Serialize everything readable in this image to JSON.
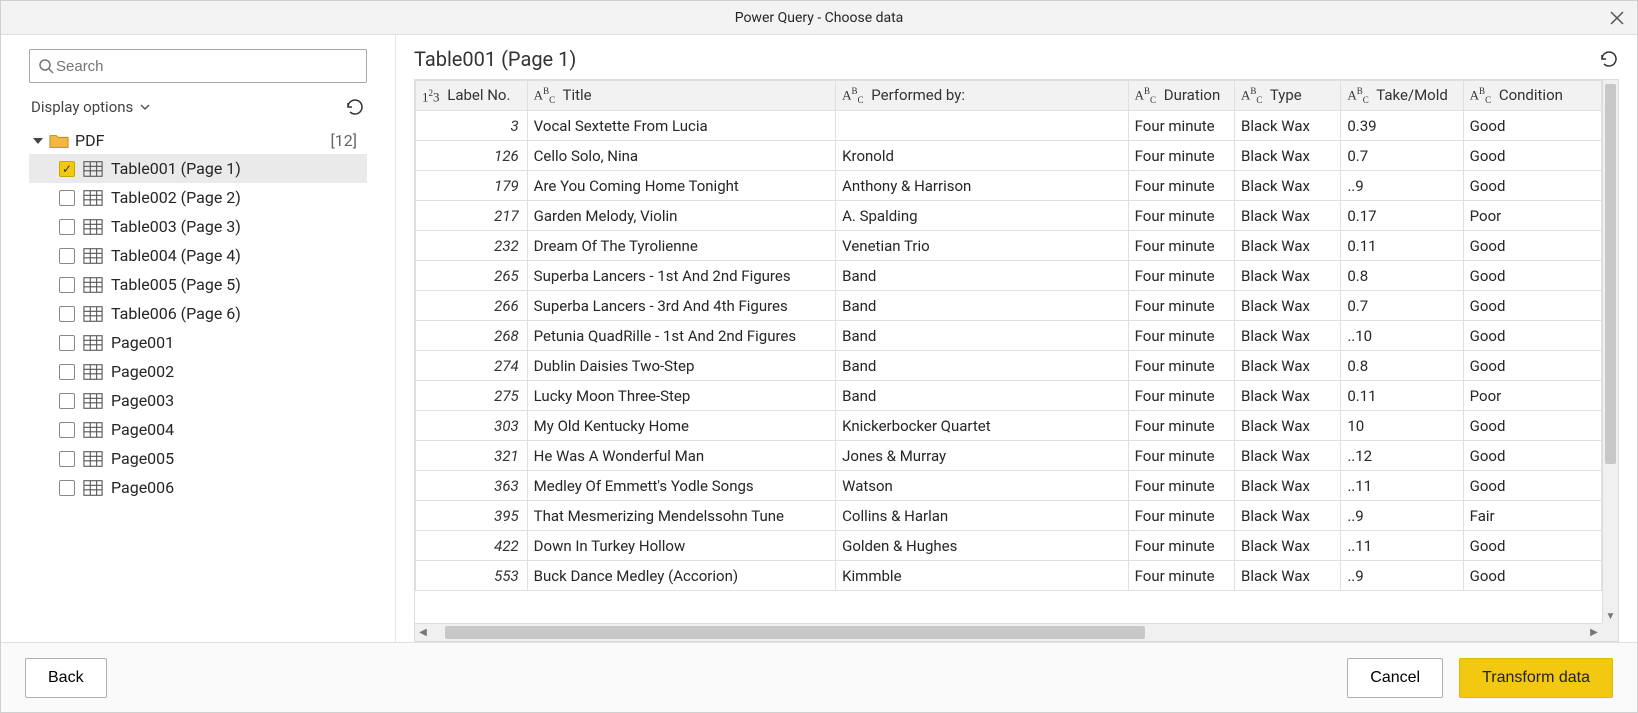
{
  "window": {
    "title": "Power Query - Choose data"
  },
  "search": {
    "placeholder": "Search"
  },
  "display_options": {
    "label": "Display options"
  },
  "tree": {
    "root_label": "PDF",
    "root_count": "[12]",
    "items": [
      {
        "label": "Table001 (Page 1)",
        "checked": true,
        "kind": "table",
        "selected": true
      },
      {
        "label": "Table002 (Page 2)",
        "checked": false,
        "kind": "table",
        "selected": false
      },
      {
        "label": "Table003 (Page 3)",
        "checked": false,
        "kind": "table",
        "selected": false
      },
      {
        "label": "Table004 (Page 4)",
        "checked": false,
        "kind": "table",
        "selected": false
      },
      {
        "label": "Table005 (Page 5)",
        "checked": false,
        "kind": "table",
        "selected": false
      },
      {
        "label": "Table006 (Page 6)",
        "checked": false,
        "kind": "table",
        "selected": false
      },
      {
        "label": "Page001",
        "checked": false,
        "kind": "page",
        "selected": false
      },
      {
        "label": "Page002",
        "checked": false,
        "kind": "page",
        "selected": false
      },
      {
        "label": "Page003",
        "checked": false,
        "kind": "page",
        "selected": false
      },
      {
        "label": "Page004",
        "checked": false,
        "kind": "page",
        "selected": false
      },
      {
        "label": "Page005",
        "checked": false,
        "kind": "page",
        "selected": false
      },
      {
        "label": "Page006",
        "checked": false,
        "kind": "page",
        "selected": false
      }
    ]
  },
  "preview": {
    "title": "Table001 (Page 1)"
  },
  "grid": {
    "columns": [
      {
        "label": "Label No.",
        "type": "number"
      },
      {
        "label": "Title",
        "type": "text"
      },
      {
        "label": "Performed by:",
        "type": "text"
      },
      {
        "label": "Duration",
        "type": "text"
      },
      {
        "label": "Type",
        "type": "text"
      },
      {
        "label": "Take/Mold",
        "type": "text"
      },
      {
        "label": "Condition",
        "type": "text"
      }
    ],
    "rows": [
      {
        "label_no": "3",
        "title": "Vocal Sextette From Lucia",
        "performed_by": "",
        "duration": "Four minute",
        "type": "Black Wax",
        "take": "0.39",
        "condition": "Good"
      },
      {
        "label_no": "126",
        "title": "Cello Solo, Nina",
        "performed_by": "Kronold",
        "duration": "Four minute",
        "type": "Black Wax",
        "take": "0.7",
        "condition": "Good"
      },
      {
        "label_no": "179",
        "title": "Are You Coming Home Tonight",
        "performed_by": "Anthony & Harrison",
        "duration": "Four minute",
        "type": "Black Wax",
        "take": "..9",
        "condition": "Good"
      },
      {
        "label_no": "217",
        "title": "Garden Melody, Violin",
        "performed_by": "A. Spalding",
        "duration": "Four minute",
        "type": "Black Wax",
        "take": "0.17",
        "condition": "Poor"
      },
      {
        "label_no": "232",
        "title": "Dream Of The Tyrolienne",
        "performed_by": "Venetian Trio",
        "duration": "Four minute",
        "type": "Black Wax",
        "take": "0.11",
        "condition": "Good"
      },
      {
        "label_no": "265",
        "title": "Superba Lancers - 1st And 2nd Figures",
        "performed_by": "Band",
        "duration": "Four minute",
        "type": "Black Wax",
        "take": "0.8",
        "condition": "Good"
      },
      {
        "label_no": "266",
        "title": "Superba Lancers - 3rd And 4th Figures",
        "performed_by": "Band",
        "duration": "Four minute",
        "type": "Black Wax",
        "take": "0.7",
        "condition": "Good"
      },
      {
        "label_no": "268",
        "title": "Petunia QuadRille - 1st And 2nd Figures",
        "performed_by": "Band",
        "duration": "Four minute",
        "type": "Black Wax",
        "take": "..10",
        "condition": "Good"
      },
      {
        "label_no": "274",
        "title": "Dublin Daisies Two-Step",
        "performed_by": "Band",
        "duration": "Four minute",
        "type": "Black Wax",
        "take": "0.8",
        "condition": "Good"
      },
      {
        "label_no": "275",
        "title": "Lucky Moon Three-Step",
        "performed_by": "Band",
        "duration": "Four minute",
        "type": "Black Wax",
        "take": "0.11",
        "condition": "Poor"
      },
      {
        "label_no": "303",
        "title": "My Old Kentucky Home",
        "performed_by": "Knickerbocker Quartet",
        "duration": "Four minute",
        "type": "Black Wax",
        "take": "10",
        "condition": "Good"
      },
      {
        "label_no": "321",
        "title": "He Was A Wonderful Man",
        "performed_by": "Jones & Murray",
        "duration": "Four minute",
        "type": "Black Wax",
        "take": "..12",
        "condition": "Good"
      },
      {
        "label_no": "363",
        "title": "Medley Of Emmett's Yodle Songs",
        "performed_by": "Watson",
        "duration": "Four minute",
        "type": "Black Wax",
        "take": "..11",
        "condition": "Good"
      },
      {
        "label_no": "395",
        "title": "That Mesmerizing Mendelssohn Tune",
        "performed_by": "Collins & Harlan",
        "duration": "Four minute",
        "type": "Black Wax",
        "take": "..9",
        "condition": "Fair"
      },
      {
        "label_no": "422",
        "title": "Down In Turkey Hollow",
        "performed_by": "Golden & Hughes",
        "duration": "Four minute",
        "type": "Black Wax",
        "take": "..11",
        "condition": "Good"
      },
      {
        "label_no": "553",
        "title": "Buck Dance Medley (Accorion)",
        "performed_by": "Kimmble",
        "duration": "Four minute",
        "type": "Black Wax",
        "take": "..9",
        "condition": "Good"
      }
    ]
  },
  "footer": {
    "back": "Back",
    "cancel": "Cancel",
    "transform": "Transform data"
  }
}
